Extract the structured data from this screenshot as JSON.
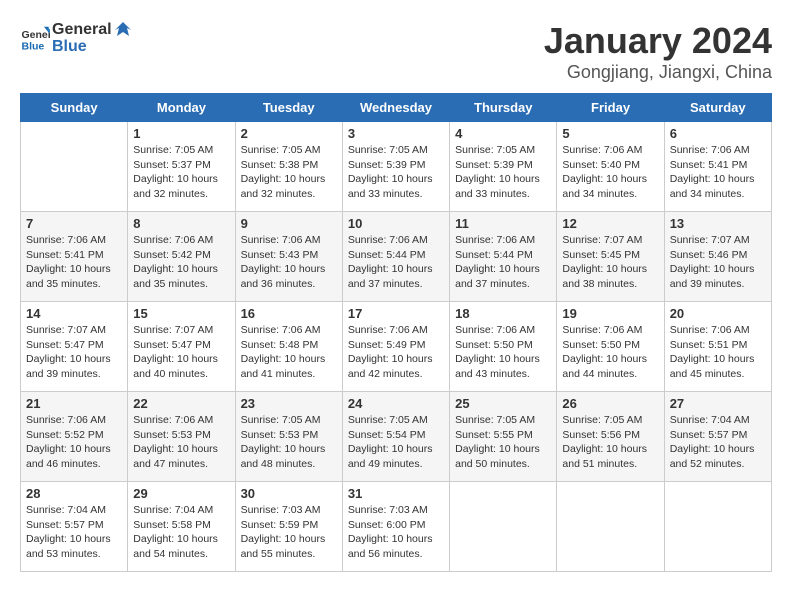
{
  "header": {
    "logo_general": "General",
    "logo_blue": "Blue",
    "title": "January 2024",
    "subtitle": "Gongjiang, Jiangxi, China"
  },
  "days_of_week": [
    "Sunday",
    "Monday",
    "Tuesday",
    "Wednesday",
    "Thursday",
    "Friday",
    "Saturday"
  ],
  "weeks": [
    [
      {
        "day": "",
        "empty": true
      },
      {
        "day": "1",
        "sunrise": "7:05 AM",
        "sunset": "5:37 PM",
        "daylight": "10 hours and 32 minutes."
      },
      {
        "day": "2",
        "sunrise": "7:05 AM",
        "sunset": "5:38 PM",
        "daylight": "10 hours and 32 minutes."
      },
      {
        "day": "3",
        "sunrise": "7:05 AM",
        "sunset": "5:39 PM",
        "daylight": "10 hours and 33 minutes."
      },
      {
        "day": "4",
        "sunrise": "7:05 AM",
        "sunset": "5:39 PM",
        "daylight": "10 hours and 33 minutes."
      },
      {
        "day": "5",
        "sunrise": "7:06 AM",
        "sunset": "5:40 PM",
        "daylight": "10 hours and 34 minutes."
      },
      {
        "day": "6",
        "sunrise": "7:06 AM",
        "sunset": "5:41 PM",
        "daylight": "10 hours and 34 minutes."
      }
    ],
    [
      {
        "day": "7",
        "sunrise": "7:06 AM",
        "sunset": "5:41 PM",
        "daylight": "10 hours and 35 minutes."
      },
      {
        "day": "8",
        "sunrise": "7:06 AM",
        "sunset": "5:42 PM",
        "daylight": "10 hours and 35 minutes."
      },
      {
        "day": "9",
        "sunrise": "7:06 AM",
        "sunset": "5:43 PM",
        "daylight": "10 hours and 36 minutes."
      },
      {
        "day": "10",
        "sunrise": "7:06 AM",
        "sunset": "5:44 PM",
        "daylight": "10 hours and 37 minutes."
      },
      {
        "day": "11",
        "sunrise": "7:06 AM",
        "sunset": "5:44 PM",
        "daylight": "10 hours and 37 minutes."
      },
      {
        "day": "12",
        "sunrise": "7:07 AM",
        "sunset": "5:45 PM",
        "daylight": "10 hours and 38 minutes."
      },
      {
        "day": "13",
        "sunrise": "7:07 AM",
        "sunset": "5:46 PM",
        "daylight": "10 hours and 39 minutes."
      }
    ],
    [
      {
        "day": "14",
        "sunrise": "7:07 AM",
        "sunset": "5:47 PM",
        "daylight": "10 hours and 39 minutes."
      },
      {
        "day": "15",
        "sunrise": "7:07 AM",
        "sunset": "5:47 PM",
        "daylight": "10 hours and 40 minutes."
      },
      {
        "day": "16",
        "sunrise": "7:06 AM",
        "sunset": "5:48 PM",
        "daylight": "10 hours and 41 minutes."
      },
      {
        "day": "17",
        "sunrise": "7:06 AM",
        "sunset": "5:49 PM",
        "daylight": "10 hours and 42 minutes."
      },
      {
        "day": "18",
        "sunrise": "7:06 AM",
        "sunset": "5:50 PM",
        "daylight": "10 hours and 43 minutes."
      },
      {
        "day": "19",
        "sunrise": "7:06 AM",
        "sunset": "5:50 PM",
        "daylight": "10 hours and 44 minutes."
      },
      {
        "day": "20",
        "sunrise": "7:06 AM",
        "sunset": "5:51 PM",
        "daylight": "10 hours and 45 minutes."
      }
    ],
    [
      {
        "day": "21",
        "sunrise": "7:06 AM",
        "sunset": "5:52 PM",
        "daylight": "10 hours and 46 minutes."
      },
      {
        "day": "22",
        "sunrise": "7:06 AM",
        "sunset": "5:53 PM",
        "daylight": "10 hours and 47 minutes."
      },
      {
        "day": "23",
        "sunrise": "7:05 AM",
        "sunset": "5:53 PM",
        "daylight": "10 hours and 48 minutes."
      },
      {
        "day": "24",
        "sunrise": "7:05 AM",
        "sunset": "5:54 PM",
        "daylight": "10 hours and 49 minutes."
      },
      {
        "day": "25",
        "sunrise": "7:05 AM",
        "sunset": "5:55 PM",
        "daylight": "10 hours and 50 minutes."
      },
      {
        "day": "26",
        "sunrise": "7:05 AM",
        "sunset": "5:56 PM",
        "daylight": "10 hours and 51 minutes."
      },
      {
        "day": "27",
        "sunrise": "7:04 AM",
        "sunset": "5:57 PM",
        "daylight": "10 hours and 52 minutes."
      }
    ],
    [
      {
        "day": "28",
        "sunrise": "7:04 AM",
        "sunset": "5:57 PM",
        "daylight": "10 hours and 53 minutes."
      },
      {
        "day": "29",
        "sunrise": "7:04 AM",
        "sunset": "5:58 PM",
        "daylight": "10 hours and 54 minutes."
      },
      {
        "day": "30",
        "sunrise": "7:03 AM",
        "sunset": "5:59 PM",
        "daylight": "10 hours and 55 minutes."
      },
      {
        "day": "31",
        "sunrise": "7:03 AM",
        "sunset": "6:00 PM",
        "daylight": "10 hours and 56 minutes."
      },
      {
        "day": "",
        "empty": true
      },
      {
        "day": "",
        "empty": true
      },
      {
        "day": "",
        "empty": true
      }
    ]
  ],
  "labels": {
    "sunrise_label": "Sunrise: ",
    "sunset_label": "Sunset: ",
    "daylight_label": "Daylight: "
  }
}
